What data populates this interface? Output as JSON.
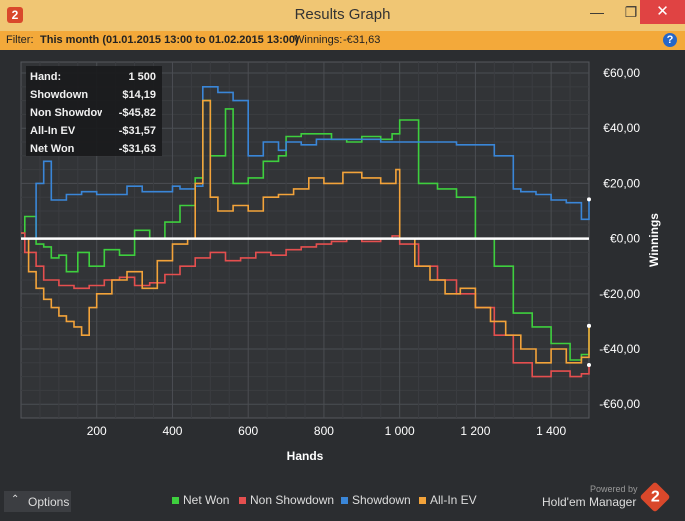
{
  "window": {
    "logo": "2",
    "title": "Results Graph",
    "minimize_glyph": "—",
    "maximize_glyph": "❐",
    "close_glyph": "✕"
  },
  "filter": {
    "prefix": "Filter:",
    "range": "This month (01.01.2015 13:00 to 01.02.2015 13:00)",
    "winnings_label": "Winnings:",
    "winnings_value": "-€31,63",
    "help_glyph": "?"
  },
  "stats": [
    {
      "label": "Hand:",
      "value": "1 500"
    },
    {
      "label": "Showdown",
      "value": "$14,19"
    },
    {
      "label": "Non Showdown",
      "value": "-$45,82"
    },
    {
      "label": "All-In EV",
      "value": "-$31,57"
    },
    {
      "label": "Net Won",
      "value": "-$31,63"
    }
  ],
  "options": {
    "chevron": "⌃",
    "label": "Options"
  },
  "branding": {
    "powered_by": "Powered by",
    "name": "Hold'em Manager",
    "logo": "2"
  },
  "chart_data": {
    "type": "line",
    "xlabel": "Hands",
    "ylabel": "Winnings",
    "xlim": [
      0,
      1500
    ],
    "ylim": [
      -65,
      64
    ],
    "x_ticks": [
      200,
      400,
      600,
      800,
      1000,
      1200,
      1400
    ],
    "x_tick_labels": [
      "200",
      "400",
      "600",
      "800",
      "1 000",
      "1 200",
      "1 400"
    ],
    "y_ticks": [
      60,
      40,
      20,
      0,
      -20,
      -40,
      -60
    ],
    "y_tick_labels": [
      "€60,00",
      "€40,00",
      "€20,00",
      "€0,00",
      "-€20,00",
      "-€40,00",
      "-€60,00"
    ],
    "grid": true,
    "legend_position": "bottom",
    "zero_line_color": "#ffffff",
    "series": [
      {
        "name": "Net Won",
        "color": "#3ecf3e",
        "x": [
          0,
          10,
          40,
          60,
          80,
          100,
          120,
          150,
          180,
          220,
          260,
          300,
          340,
          380,
          420,
          460,
          480,
          500,
          540,
          560,
          600,
          640,
          680,
          700,
          740,
          780,
          820,
          860,
          900,
          950,
          980,
          1000,
          1050,
          1100,
          1150,
          1200,
          1250,
          1300,
          1350,
          1400,
          1450,
          1480,
          1500
        ],
        "y": [
          2,
          8,
          -2,
          -3,
          -7,
          -6,
          -12,
          -5,
          -10,
          -4,
          -6,
          3,
          0,
          6,
          12,
          22,
          50,
          30,
          47,
          20,
          22,
          28,
          30,
          37,
          38,
          38,
          36,
          35,
          37,
          36,
          38,
          43,
          20,
          18,
          15,
          0,
          -10,
          -27,
          -32,
          -38,
          -44,
          -42,
          -31.6
        ]
      },
      {
        "name": "Non Showdown",
        "color": "#e54f4f",
        "x": [
          0,
          10,
          40,
          60,
          100,
          140,
          180,
          220,
          260,
          300,
          340,
          380,
          420,
          460,
          500,
          540,
          580,
          620,
          660,
          700,
          740,
          780,
          820,
          860,
          900,
          950,
          980,
          1000,
          1050,
          1100,
          1150,
          1200,
          1250,
          1300,
          1350,
          1400,
          1450,
          1480,
          1500
        ],
        "y": [
          2,
          -5,
          -10,
          -15,
          -17,
          -18,
          -17,
          -15,
          -14,
          -17,
          -16,
          -13,
          -10,
          -7,
          -5,
          -8,
          -7,
          -5,
          -6,
          -4,
          -3,
          -2,
          -1,
          0,
          -1,
          0,
          1,
          -2,
          -10,
          -15,
          -20,
          -25,
          -35,
          -45,
          -50,
          -48,
          -50,
          -49,
          -45.8
        ]
      },
      {
        "name": "Showdown",
        "color": "#3a86d8",
        "x": [
          0,
          40,
          60,
          80,
          120,
          160,
          200,
          240,
          280,
          320,
          360,
          400,
          420,
          460,
          480,
          520,
          560,
          600,
          640,
          680,
          700,
          740,
          780,
          820,
          860,
          900,
          950,
          1000,
          1050,
          1100,
          1150,
          1200,
          1250,
          1300,
          1320,
          1360,
          1400,
          1440,
          1480,
          1500
        ],
        "y": [
          0,
          20,
          28,
          14,
          16,
          17,
          16,
          16,
          19,
          17,
          17,
          19,
          18,
          19,
          55,
          53,
          50,
          30,
          35,
          32,
          35,
          34,
          36,
          36,
          36,
          36,
          35,
          35,
          35,
          35,
          34,
          34,
          30,
          18,
          17,
          16,
          14,
          13,
          7,
          14.2
        ]
      },
      {
        "name": "All-In EV",
        "color": "#f3a33a",
        "x": [
          0,
          20,
          40,
          60,
          80,
          100,
          120,
          140,
          160,
          180,
          200,
          240,
          280,
          320,
          360,
          400,
          440,
          460,
          480,
          500,
          520,
          560,
          600,
          640,
          680,
          720,
          760,
          800,
          850,
          900,
          950,
          990,
          1000,
          1040,
          1080,
          1120,
          1160,
          1200,
          1240,
          1280,
          1320,
          1360,
          1400,
          1440,
          1480,
          1500
        ],
        "y": [
          0,
          -12,
          -18,
          -22,
          -25,
          -28,
          -30,
          -32,
          -35,
          -25,
          -20,
          -15,
          -12,
          -18,
          -8,
          -2,
          0,
          20,
          50,
          15,
          10,
          12,
          10,
          15,
          16,
          18,
          22,
          20,
          24,
          22,
          20,
          25,
          0,
          -10,
          -15,
          -20,
          -18,
          -25,
          -30,
          -35,
          -40,
          -45,
          -40,
          -45,
          -43,
          -31.6
        ]
      }
    ]
  }
}
